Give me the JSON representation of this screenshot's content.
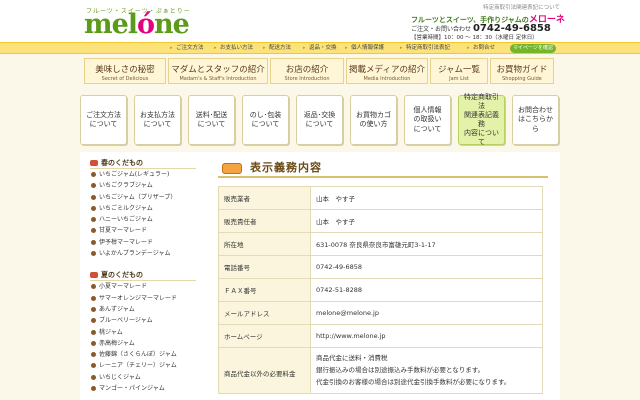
{
  "header": {
    "tagline": "フルーツ・スイーツ・ぷぁとりー",
    "logo_pre": "mel",
    "logo_accent": "ó",
    "logo_post": "ne",
    "top_note": "特定商取引法関連表記について",
    "brand_prefix": "フルーツとスイーツ、手作りジャムの",
    "brand_name": "メローネ",
    "contact_label": "ご注文・お問い合わせ",
    "tel": "0742-49-6858",
    "hours": "【営業時間】10：00 ～ 18：30（水曜日 定休日）"
  },
  "util_nav": [
    "ご注文方法",
    "お支払い方法",
    "配送方法",
    "返品・交換",
    "個人情報保護",
    "特定商取引法表記",
    "お問合せ"
  ],
  "mypage_label": "マイページを確認",
  "main_nav": [
    {
      "jp": "美味しさの秘密",
      "en": "Secret of Delicious"
    },
    {
      "jp": "マダムとスタッフの紹介",
      "en": "Madam's & Staff's Introduction"
    },
    {
      "jp": "お店の紹介",
      "en": "Store Introduction"
    },
    {
      "jp": "掲載メディアの紹介",
      "en": "Media Introduction"
    },
    {
      "jp": "ジャム一覧",
      "en": "Jam List"
    },
    {
      "jp": "お買物ガイド",
      "en": "Shopping Guide"
    }
  ],
  "buttons": [
    {
      "line1": "ご注文方法",
      "line2": "について",
      "line3": ""
    },
    {
      "line1": "お支払方法",
      "line2": "について",
      "line3": ""
    },
    {
      "line1": "送料･配送",
      "line2": "について",
      "line3": ""
    },
    {
      "line1": "のし･包装",
      "line2": "について",
      "line3": ""
    },
    {
      "line1": "返品･交換",
      "line2": "について",
      "line3": ""
    },
    {
      "line1": "お買物カゴ",
      "line2": "の使い方",
      "line3": ""
    },
    {
      "line1": "個人情報",
      "line2": "の取扱い",
      "line3": "について"
    },
    {
      "line1": "特定商取引法",
      "line2": "関連表記義務",
      "line3": "内容について"
    },
    {
      "line1": "お問合わせ",
      "line2": "はこちらから",
      "line3": ""
    }
  ],
  "sidebar": {
    "spring_title": "春のくだもの",
    "spring_items": [
      "いちごジャム(レギュラー)",
      "いちごクラブジャム",
      "いちごジャム（プリザーブ）",
      "いちごミルクジャム",
      "ハニーいちごジャム",
      "甘夏マーマレード",
      "伊予柑マーマレード",
      "いよかんブランデージャム"
    ],
    "summer_title": "夏のくだもの",
    "summer_items": [
      "小夏マーマレード",
      "サマーオレンジマーマレード",
      "あんずジャム",
      "ブルーベリージャム",
      "桃ジャム",
      "赤高梅ジャム",
      "佐藤錦（さくらんぼ）ジャム",
      "レーニア（チェリー）ジャム",
      "いちじくジャム",
      "マンゴー・パインジャム"
    ]
  },
  "main": {
    "title": "表示義務内容",
    "rows": [
      {
        "k": "販売業者",
        "v": "山本　やす子"
      },
      {
        "k": "販売責任者",
        "v": "山本　やす子"
      },
      {
        "k": "所在地",
        "v": "631-0078 奈良県奈良市富雄元町3-1-17"
      },
      {
        "k": "電話番号",
        "v": "0742-49-6858"
      },
      {
        "k": "ＦＡＸ番号",
        "v": "0742-51-8288"
      },
      {
        "k": "メールアドレス",
        "v": "melone@melone.jp"
      },
      {
        "k": "ホームページ",
        "v": "http://www.melone.jp"
      }
    ],
    "extra_key": "商品代金以外の必要料金",
    "extra_lines": [
      "商品代金に送料・消費税",
      "銀行振込みの場合は別途振込み手数料が必要となります。",
      "代金引換のお客様の場合は別途代金引換手数料が必要になります。"
    ]
  }
}
